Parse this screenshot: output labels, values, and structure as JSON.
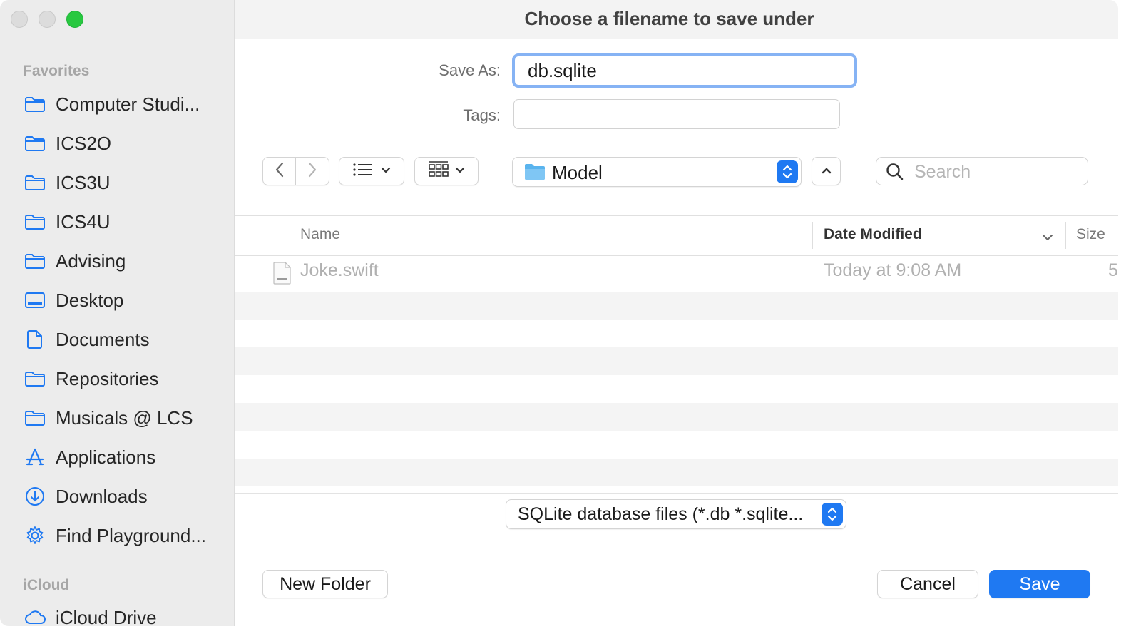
{
  "window": {
    "title": "Choose a filename to save under"
  },
  "sidebar": {
    "favorites_header": "Favorites",
    "icloud_header": "iCloud",
    "items": [
      {
        "label": "Computer Studi...",
        "icon": "folder-icon"
      },
      {
        "label": "ICS2O",
        "icon": "folder-icon"
      },
      {
        "label": "ICS3U",
        "icon": "folder-icon"
      },
      {
        "label": "ICS4U",
        "icon": "folder-icon"
      },
      {
        "label": "Advising",
        "icon": "folder-icon"
      },
      {
        "label": "Desktop",
        "icon": "desktop-icon"
      },
      {
        "label": "Documents",
        "icon": "document-icon"
      },
      {
        "label": "Repositories",
        "icon": "folder-icon"
      },
      {
        "label": "Musicals @ LCS",
        "icon": "folder-icon"
      },
      {
        "label": "Applications",
        "icon": "applications-icon"
      },
      {
        "label": "Downloads",
        "icon": "download-icon"
      },
      {
        "label": "Find Playground...",
        "icon": "gear-icon"
      }
    ],
    "icloud_items": [
      {
        "label": "iCloud Drive",
        "icon": "cloud-icon"
      }
    ]
  },
  "form": {
    "save_as_label": "Save As:",
    "save_as_value": "db.sqlite",
    "tags_label": "Tags:",
    "tags_value": ""
  },
  "toolbar": {
    "location": "Model",
    "search_placeholder": "Search"
  },
  "columns": {
    "name": "Name",
    "date": "Date Modified",
    "size": "Size"
  },
  "files": [
    {
      "name": "Joke.swift",
      "date": "Today at 9:08 AM",
      "size": "5"
    }
  ],
  "format": {
    "selected": "SQLite database files (*.db *.sqlite..."
  },
  "buttons": {
    "new_folder": "New Folder",
    "cancel": "Cancel",
    "save": "Save"
  },
  "colors": {
    "accent": "#1f79f2",
    "sidebar_icon": "#1f79f2",
    "focus_ring": "#86b3f4"
  }
}
